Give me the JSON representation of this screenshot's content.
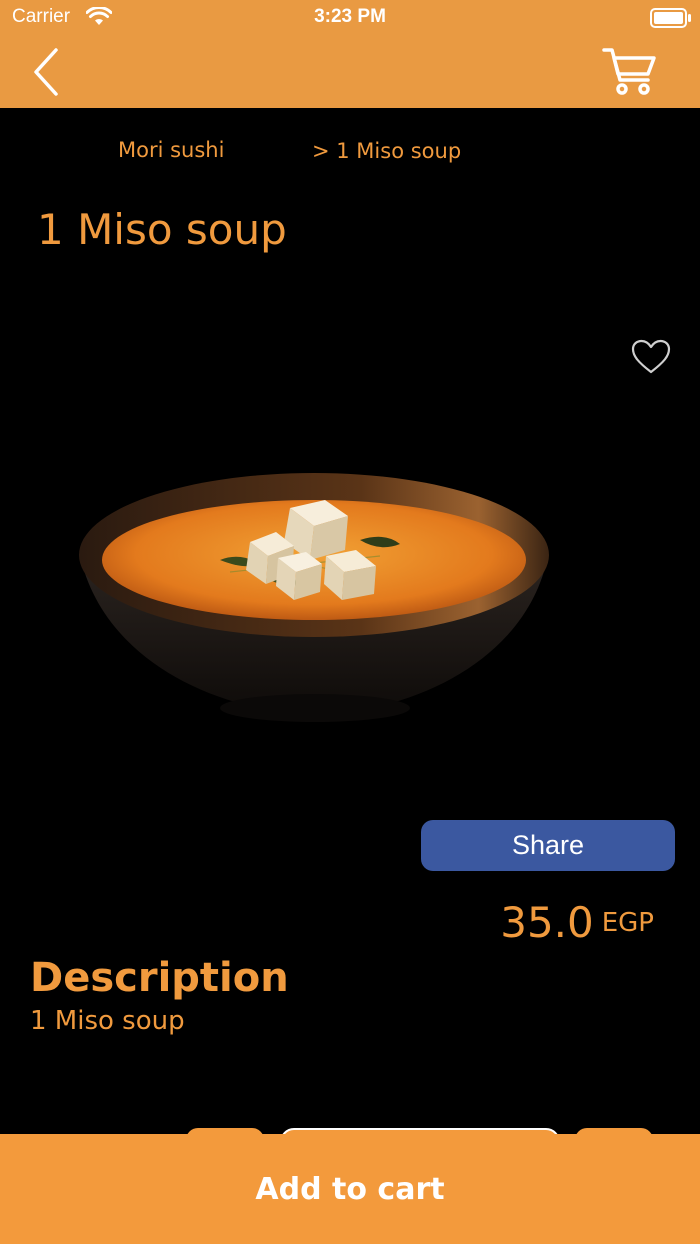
{
  "status_bar": {
    "carrier": "Carrier",
    "time": "3:23 PM"
  },
  "nav": {
    "back_icon": "chevron-left-icon",
    "cart_icon": "shopping-cart-icon"
  },
  "breadcrumb": {
    "home": "Mori sushi",
    "current": "> 1 Miso soup"
  },
  "product": {
    "title": "1 Miso soup",
    "price": "35.0",
    "currency": "EGP",
    "share_label": "Share",
    "favorite_icon": "heart-outline-icon"
  },
  "description": {
    "heading": "Description",
    "text": "1 Miso soup"
  },
  "cart": {
    "add_label": "Add to cart"
  },
  "colors": {
    "accent": "#e99a42",
    "text_accent": "#f09a3e",
    "share_blue": "#3b58a0",
    "background": "#000000"
  }
}
